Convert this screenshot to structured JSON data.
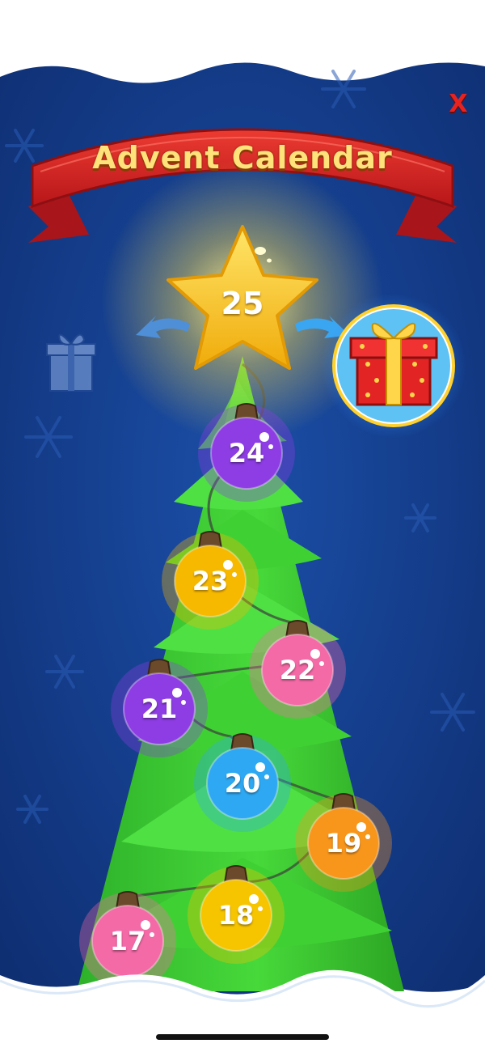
{
  "title": "Advent Calendar",
  "close_label": "X",
  "star_day": "25",
  "days": [
    {
      "day": "24",
      "color": "#8d3de3"
    },
    {
      "day": "23",
      "color": "#f7b800"
    },
    {
      "day": "22",
      "color": "#f36aa6"
    },
    {
      "day": "21",
      "color": "#8d3de3"
    },
    {
      "day": "20",
      "color": "#2ea8f2"
    },
    {
      "day": "19",
      "color": "#f8961b"
    },
    {
      "day": "18",
      "color": "#f7c400"
    },
    {
      "day": "17",
      "color": "#f36aa6"
    }
  ],
  "colors": {
    "background": "#143d8c",
    "tree": "#3ccf2f",
    "banner": "#d9241f",
    "star": "#f8cf1c",
    "gift_box": "#e32424",
    "gift_ribbon": "#ffd54a"
  },
  "icons": {
    "prev_gift": "gift-icon-dimmed",
    "reward_gift": "gift-icon",
    "left_arrow": "curved-arrow-left-icon",
    "right_arrow": "curved-arrow-right-icon"
  }
}
